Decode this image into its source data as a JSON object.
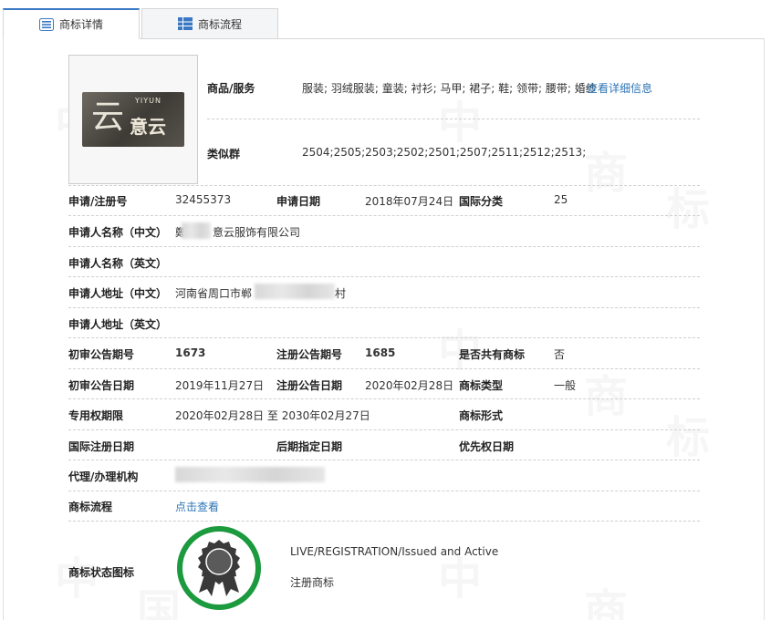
{
  "tabs": [
    {
      "label": "商标详情",
      "active": true
    },
    {
      "label": "商标流程",
      "active": false
    }
  ],
  "goods_services": {
    "label": "商品/服务",
    "value": "服装; 羽绒服装; 童装; 衬衫; 马甲; 裙子; 鞋; 领带; 腰带; 婚纱",
    "more_link": "查看详细信息"
  },
  "similar_group": {
    "label": "类似群",
    "value": "2504;2505;2503;2502;2501;2507;2511;2512;2513;"
  },
  "reg_no": {
    "label": "申请/注册号",
    "value": "32455373"
  },
  "apply_date": {
    "label": "申请日期",
    "value": "2018年07月24日"
  },
  "intl_class": {
    "label": "国际分类",
    "value": "25"
  },
  "applicant_cn": {
    "label": "申请人名称（中文）",
    "value_prefix": "鄭",
    "value": "意云服饰有限公司"
  },
  "applicant_en": {
    "label": "申请人名称（英文）",
    "value": ""
  },
  "address_cn": {
    "label": "申请人地址（中文）",
    "value_prefix": "河南省周口市郸",
    "value_suffix": "村"
  },
  "address_en": {
    "label": "申请人地址（英文）",
    "value": ""
  },
  "prelim_no": {
    "label": "初审公告期号",
    "value": "1673"
  },
  "reg_pub_no": {
    "label": "注册公告期号",
    "value": "1685"
  },
  "shared": {
    "label": "是否共有商标",
    "value": "否"
  },
  "prelim_date": {
    "label": "初审公告日期",
    "value": "2019年11月27日"
  },
  "reg_pub_date": {
    "label": "注册公告日期",
    "value": "2020年02月28日"
  },
  "tm_type": {
    "label": "商标类型",
    "value": "一般"
  },
  "exclusive": {
    "label": "专用权期限",
    "value": "2020年02月28日 至 2030年02月27日"
  },
  "tm_form": {
    "label": "商标形式",
    "value": ""
  },
  "intl_reg_date": {
    "label": "国际注册日期",
    "value": ""
  },
  "later_date": {
    "label": "后期指定日期",
    "value": ""
  },
  "priority_date": {
    "label": "优先权日期",
    "value": ""
  },
  "agent": {
    "label": "代理/办理机构",
    "value": ""
  },
  "process": {
    "label": "商标流程",
    "link": "点击查看"
  },
  "status": {
    "label": "商标状态图标",
    "en": "LIVE/REGISTRATION/Issued and Active",
    "cn": "注册商标"
  },
  "logo": {
    "text_main": "云",
    "text_en": "YIYUN",
    "text_cn": "意云"
  },
  "colors": {
    "accent": "#3a78c3",
    "link": "#2e75b6",
    "status_green": "#1c9a3e"
  }
}
